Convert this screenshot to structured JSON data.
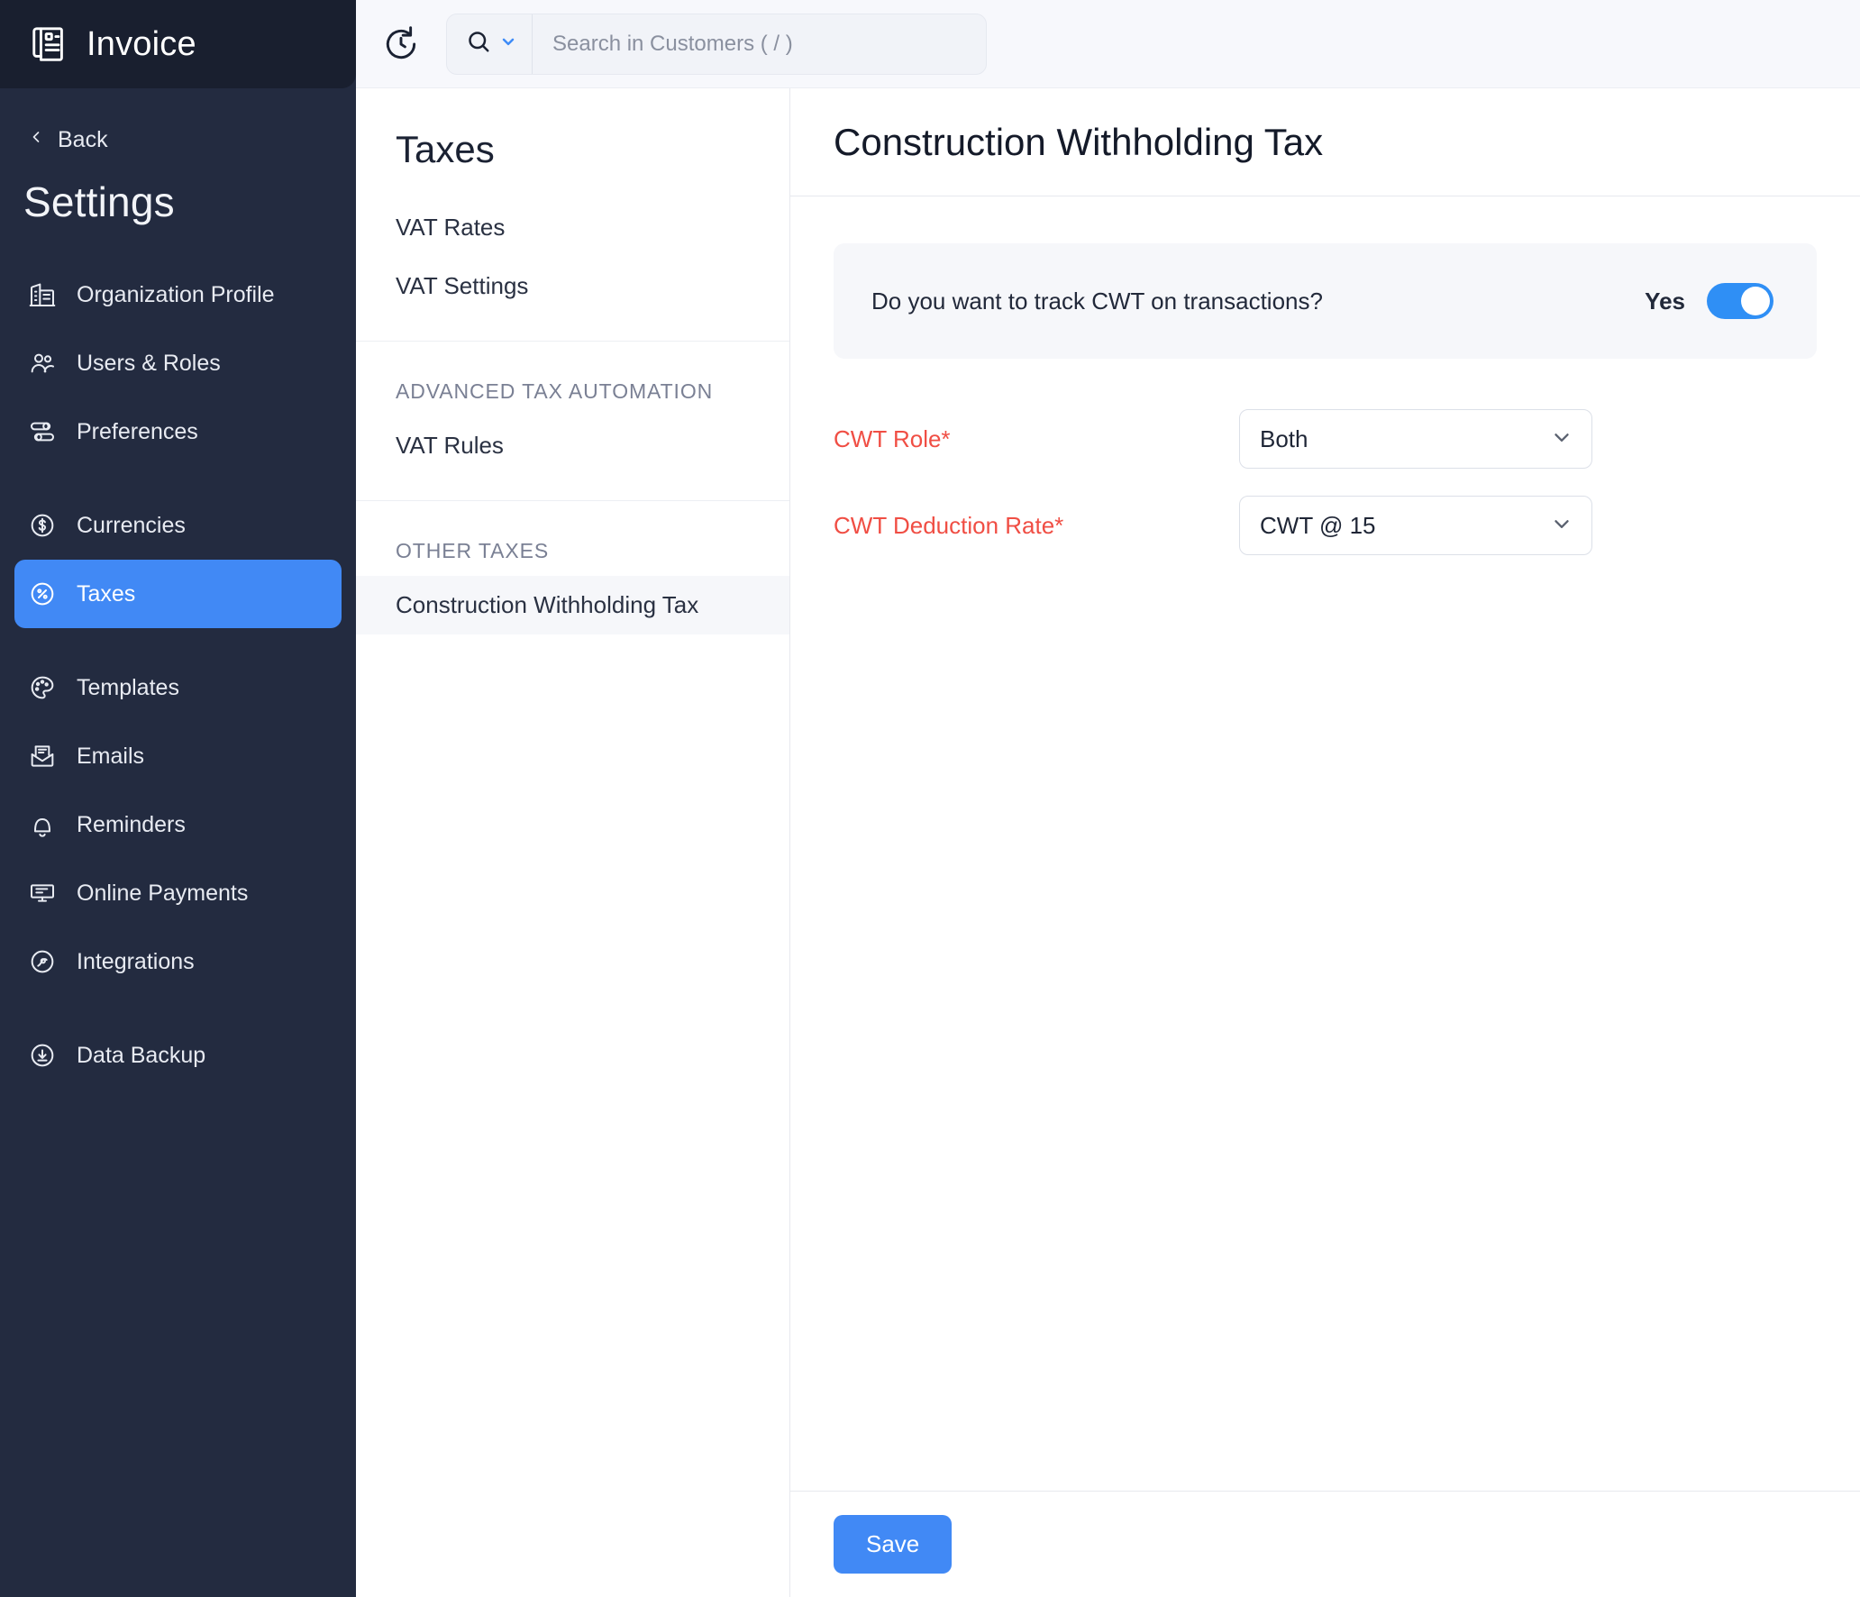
{
  "brand": {
    "title": "Invoice",
    "icon": "invoice-document-icon"
  },
  "sidebar": {
    "back_label": "Back",
    "section_title": "Settings",
    "groups": [
      {
        "items": [
          {
            "label": "Organization Profile",
            "icon": "building-icon"
          },
          {
            "label": "Users & Roles",
            "icon": "users-icon"
          },
          {
            "label": "Preferences",
            "icon": "sliders-icon"
          }
        ]
      },
      {
        "items": [
          {
            "label": "Currencies",
            "icon": "dollar-circle-icon"
          },
          {
            "label": "Taxes",
            "icon": "percent-circle-icon",
            "active": true
          }
        ]
      },
      {
        "items": [
          {
            "label": "Templates",
            "icon": "palette-icon"
          },
          {
            "label": "Emails",
            "icon": "envelope-icon"
          },
          {
            "label": "Reminders",
            "icon": "bell-icon"
          },
          {
            "label": "Online Payments",
            "icon": "card-monitor-icon"
          },
          {
            "label": "Integrations",
            "icon": "integration-circle-icon"
          }
        ]
      },
      {
        "items": [
          {
            "label": "Data Backup",
            "icon": "download-circle-icon"
          }
        ]
      }
    ]
  },
  "topbar": {
    "refresh_icon": "history-refresh-icon",
    "search_icon": "search-icon",
    "search_dropdown_icon": "chevron-down-icon",
    "search_placeholder": "Search in Customers ( / )",
    "search_value": ""
  },
  "taxes_panel": {
    "title": "Taxes",
    "sections": [
      {
        "header": "",
        "items": [
          {
            "label": "VAT Rates"
          },
          {
            "label": "VAT Settings"
          }
        ]
      },
      {
        "header": "ADVANCED TAX AUTOMATION",
        "items": [
          {
            "label": "VAT Rules"
          }
        ]
      },
      {
        "header": "OTHER TAXES",
        "items": [
          {
            "label": "Construction Withholding Tax",
            "selected": true
          }
        ]
      }
    ]
  },
  "main": {
    "title": "Construction Withholding Tax",
    "toggle": {
      "question": "Do you want to track CWT on transactions?",
      "state_label": "Yes",
      "enabled": true
    },
    "fields": [
      {
        "label": "CWT Role*",
        "value": "Both",
        "chevron_icon": "chevron-down-icon"
      },
      {
        "label": "CWT Deduction Rate*",
        "value": "CWT @ 15",
        "chevron_icon": "chevron-down-icon"
      }
    ],
    "save_label": "Save"
  },
  "colors": {
    "sidebar_bg": "#232B40",
    "brand_bg": "#191F2F",
    "accent_blue": "#4189F5",
    "toggle_blue": "#2F8FF5",
    "required_red": "#F04E44",
    "selected_row": "#F6F7FA"
  }
}
